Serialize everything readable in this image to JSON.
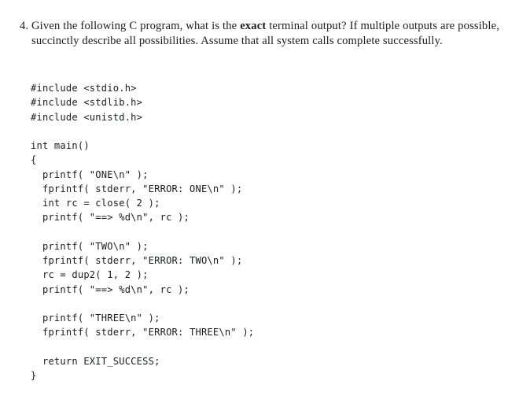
{
  "document": {
    "type": "exam-question",
    "background_color": "#ffffff",
    "text_color": "#1a1c24"
  },
  "question": {
    "number": "4.",
    "text_before_bold": "Given the following C program, what is the ",
    "bold_word": "exact",
    "text_after_bold": " terminal output? If multiple outputs are possible, succinctly describe all possibilities. Assume that all system calls complete successfully."
  },
  "code": {
    "language": "c",
    "lines": [
      "#include <stdio.h>",
      "#include <stdlib.h>",
      "#include <unistd.h>",
      "",
      "int main()",
      "{",
      "  printf( \"ONE\\n\" );",
      "  fprintf( stderr, \"ERROR: ONE\\n\" );",
      "  int rc = close( 2 );",
      "  printf( \"==> %d\\n\", rc );",
      "",
      "  printf( \"TWO\\n\" );",
      "  fprintf( stderr, \"ERROR: TWO\\n\" );",
      "  rc = dup2( 1, 2 );",
      "  printf( \"==> %d\\n\", rc );",
      "",
      "  printf( \"THREE\\n\" );",
      "  fprintf( stderr, \"ERROR: THREE\\n\" );",
      "",
      "  return EXIT_SUCCESS;",
      "}"
    ]
  }
}
